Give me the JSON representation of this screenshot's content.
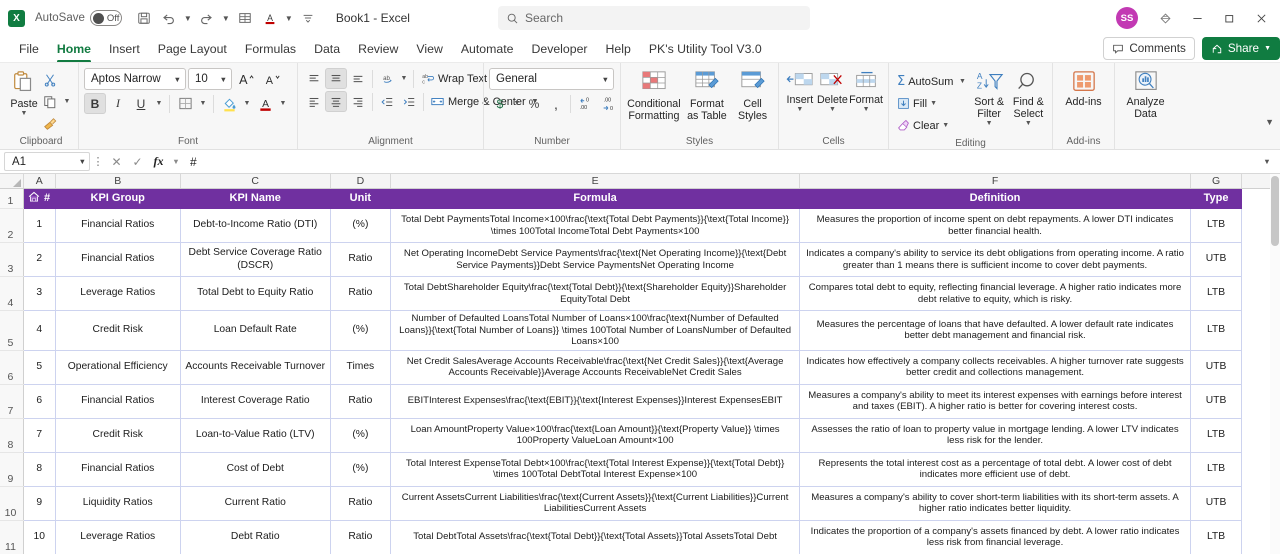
{
  "titlebar": {
    "logo_text": "X",
    "autosave_label": "AutoSave",
    "autosave_state": "Off",
    "doc_title": "Book1  -  Excel",
    "quick_access": [
      {
        "name": "save-icon",
        "glyph": "💾"
      },
      {
        "name": "undo-icon",
        "glyph": "↶"
      },
      {
        "name": "redo-icon",
        "glyph": "↷"
      },
      {
        "name": "table-icon",
        "glyph": "⊞"
      },
      {
        "name": "font-color-icon",
        "glyph": "A"
      },
      {
        "name": "customize-quick-access-toolbar-icon",
        "glyph": "☰"
      }
    ],
    "avatar_initials": "SS",
    "avatar_color": "#c239b3",
    "window_buttons": [
      "—",
      "❐",
      "✕"
    ],
    "diamond_icon": "◈"
  },
  "search": {
    "placeholder": "Search"
  },
  "menubar": {
    "tabs": [
      {
        "label": "File",
        "active": false
      },
      {
        "label": "Home",
        "active": true
      },
      {
        "label": "Insert",
        "active": false
      },
      {
        "label": "Page Layout",
        "active": false
      },
      {
        "label": "Formulas",
        "active": false
      },
      {
        "label": "Data",
        "active": false
      },
      {
        "label": "Review",
        "active": false
      },
      {
        "label": "View",
        "active": false
      },
      {
        "label": "Automate",
        "active": false
      },
      {
        "label": "Developer",
        "active": false
      },
      {
        "label": "Help",
        "active": false
      },
      {
        "label": "PK's Utility Tool V3.0",
        "active": false
      }
    ],
    "comments_label": "Comments",
    "share_label": "Share"
  },
  "ribbon": {
    "clipboard": {
      "group_label": "Clipboard",
      "paste_label": "Paste",
      "cut_label": "Cut",
      "copy_label": "Copy",
      "format_painter_label": "Format Painter"
    },
    "font": {
      "group_label": "Font",
      "font_name": "Aptos Narrow",
      "font_size": "10",
      "grow_font": "A",
      "shrink_font": "A",
      "bold": "B",
      "italic": "I",
      "underline": "U",
      "borders": "Borders",
      "fill_color": "Fill Color",
      "font_color": "A"
    },
    "alignment": {
      "group_label": "Alignment",
      "wrap_text_label": "Wrap Text",
      "merge_center_label": "Merge & Center",
      "orientation_label": "Orientation",
      "decrease_indent": "Decrease Indent",
      "increase_indent": "Increase Indent"
    },
    "number": {
      "group_label": "Number",
      "format_value": "General",
      "accounting": "$",
      "percent": "%",
      "comma": ",",
      "increase_decimal": ".00",
      "decrease_decimal": ".00"
    },
    "styles": {
      "group_label": "Styles",
      "conditional_formatting": "Conditional Formatting",
      "format_as_table": "Format as Table",
      "cell_styles": "Cell Styles"
    },
    "cells": {
      "group_label": "Cells",
      "insert": "Insert",
      "delete": "Delete",
      "format": "Format"
    },
    "editing": {
      "group_label": "Editing",
      "autosum": "AutoSum",
      "fill": "Fill",
      "clear": "Clear",
      "sort_filter": "Sort & Filter",
      "find_select": "Find & Select"
    },
    "addins": {
      "group_label": "Add-ins",
      "addins_label": "Add-ins",
      "analyze_data_label": "Analyze Data"
    }
  },
  "formula_bar": {
    "name_box_value": "A1",
    "cancel_icon": "✕",
    "enter_icon": "✓",
    "fx_icon": "fx",
    "formula_value": "#"
  },
  "grid": {
    "column_letters": [
      "A",
      "B",
      "C",
      "D",
      "E",
      "F",
      "G"
    ],
    "row_numbers": [
      "1",
      "2",
      "3",
      "4",
      "5",
      "6",
      "7",
      "8",
      "9",
      "10",
      "11"
    ],
    "header_bg": "#7030a0",
    "header_fg": "#ffffff",
    "headers": [
      "#",
      "KPI Group",
      "KPI Name",
      "Unit",
      "Formula",
      "Definition",
      "Type"
    ],
    "home_icon": "🏠",
    "rows": [
      {
        "num": "1",
        "group": "Financial Ratios",
        "name": "Debt-to-Income Ratio (DTI)",
        "unit": "(%)",
        "formula": "Total Debt PaymentsTotal Income×100\\frac{\\text{Total Debt Payments}}{\\text{Total Income}} \\times 100Total IncomeTotal Debt Payments×100",
        "definition": "Measures the proportion of income spent on debt repayments. A lower DTI indicates better financial health.",
        "type": "LTB"
      },
      {
        "num": "2",
        "group": "Financial Ratios",
        "name": "Debt Service Coverage Ratio (DSCR)",
        "unit": "Ratio",
        "formula": "Net Operating IncomeDebt Service Payments\\frac{\\text{Net Operating Income}}{\\text{Debt Service Payments}}Debt Service PaymentsNet Operating Income",
        "definition": "Indicates a company's ability to service its debt obligations from operating income. A ratio greater than 1 means there is sufficient income to cover debt payments.",
        "type": "UTB"
      },
      {
        "num": "3",
        "group": "Leverage Ratios",
        "name": "Total Debt to Equity Ratio",
        "unit": "Ratio",
        "formula": "Total DebtShareholder Equity\\frac{\\text{Total Debt}}{\\text{Shareholder Equity}}Shareholder EquityTotal Debt",
        "definition": "Compares total debt to equity, reflecting financial leverage. A higher ratio indicates more debt relative to equity, which is risky.",
        "type": "LTB"
      },
      {
        "num": "4",
        "group": "Credit Risk",
        "name": "Loan Default Rate",
        "unit": "(%)",
        "formula": "Number of Defaulted LoansTotal Number of Loans×100\\frac{\\text{Number of Defaulted Loans}}{\\text{Total Number of Loans}} \\times 100Total Number of LoansNumber of Defaulted Loans×100",
        "definition": "Measures the percentage of loans that have defaulted. A lower default rate indicates better debt management and financial risk.",
        "type": "LTB"
      },
      {
        "num": "5",
        "group": "Operational Efficiency",
        "name": "Accounts Receivable Turnover",
        "unit": "Times",
        "formula": "Net Credit SalesAverage Accounts Receivable\\frac{\\text{Net Credit Sales}}{\\text{Average Accounts Receivable}}Average Accounts ReceivableNet Credit Sales",
        "definition": "Indicates how effectively a company collects receivables. A higher turnover rate suggests better credit and collections management.",
        "type": "UTB"
      },
      {
        "num": "6",
        "group": "Financial Ratios",
        "name": "Interest Coverage Ratio",
        "unit": "Ratio",
        "formula": "EBITInterest Expenses\\frac{\\text{EBIT}}{\\text{Interest Expenses}}Interest ExpensesEBIT",
        "definition": "Measures a company's ability to meet its interest expenses with earnings before interest and taxes (EBIT). A higher ratio is better for covering interest costs.",
        "type": "UTB"
      },
      {
        "num": "7",
        "group": "Credit Risk",
        "name": "Loan-to-Value Ratio (LTV)",
        "unit": "(%)",
        "formula": "Loan AmountProperty Value×100\\frac{\\text{Loan Amount}}{\\text{Property Value}} \\times 100Property ValueLoan Amount×100",
        "definition": "Assesses the ratio of loan to property value in mortgage lending. A lower LTV indicates less risk for the lender.",
        "type": "LTB"
      },
      {
        "num": "8",
        "group": "Financial Ratios",
        "name": "Cost of Debt",
        "unit": "(%)",
        "formula": "Total Interest ExpenseTotal Debt×100\\frac{\\text{Total Interest Expense}}{\\text{Total Debt}} \\times 100Total DebtTotal Interest Expense×100",
        "definition": "Represents the total interest cost as a percentage of total debt. A lower cost of debt indicates more efficient use of debt.",
        "type": "LTB"
      },
      {
        "num": "9",
        "group": "Liquidity Ratios",
        "name": "Current Ratio",
        "unit": "Ratio",
        "formula": "Current AssetsCurrent Liabilities\\frac{\\text{Current Assets}}{\\text{Current Liabilities}}Current LiabilitiesCurrent Assets",
        "definition": "Measures a company's ability to cover short-term liabilities with its short-term assets. A higher ratio indicates better liquidity.",
        "type": "UTB"
      },
      {
        "num": "10",
        "group": "Leverage Ratios",
        "name": "Debt Ratio",
        "unit": "Ratio",
        "formula": "Total DebtTotal Assets\\frac{\\text{Total Debt}}{\\text{Total Assets}}Total AssetsTotal Debt",
        "definition": "Indicates the proportion of a company's assets financed by debt. A lower ratio indicates less risk from financial leverage.",
        "type": "LTB"
      }
    ]
  }
}
